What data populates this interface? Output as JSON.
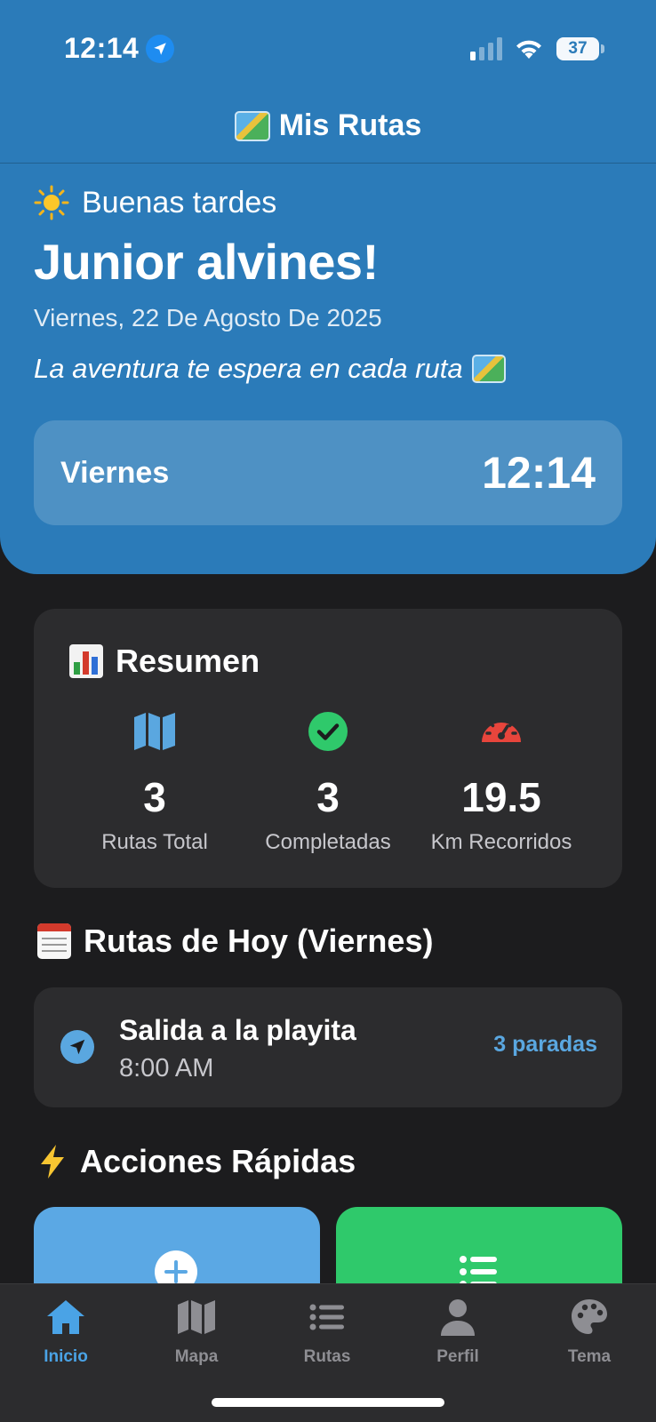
{
  "status_bar": {
    "time": "12:14",
    "battery": "37",
    "icons": [
      "location-arrow-icon",
      "cellular-signal-icon",
      "wifi-icon",
      "battery-icon"
    ]
  },
  "header": {
    "title": "Mis Rutas",
    "title_icon": "world-map-emoji-icon",
    "greeting_icon": "sun-emoji-icon",
    "greeting": "Buenas tardes",
    "user_name": "Junior alvines!",
    "date": "Viernes, 22 De Agosto De 2025",
    "tagline": "La aventura te espera en cada ruta",
    "day_card": {
      "day": "Viernes",
      "time": "12:14"
    },
    "color": "#2b7bb9"
  },
  "summary": {
    "title": "Resumen",
    "title_icon": "bar-chart-emoji-icon",
    "stats": [
      {
        "value": "3",
        "label": "Rutas Total",
        "icon": "map-icon",
        "color": "#5aa7e0"
      },
      {
        "value": "3",
        "label": "Completadas",
        "icon": "check-circle-icon",
        "color": "#2fc96b"
      },
      {
        "value": "19.5",
        "label": "Km Recorridos",
        "icon": "speedometer-icon",
        "color": "#e8453c"
      }
    ]
  },
  "today": {
    "title": "Rutas de Hoy (Viernes)",
    "title_icon": "calendar-emoji-icon",
    "routes": [
      {
        "name": "Salida a la playita",
        "time": "8:00 AM",
        "stops": "3 paradas",
        "icon": "navigation-arrow-icon"
      }
    ]
  },
  "quick_actions": {
    "title": "Acciones Rápidas",
    "title_icon": "lightning-emoji-icon",
    "buttons": [
      {
        "icon": "plus-circle-icon",
        "color": "#5ba8e4"
      },
      {
        "icon": "list-icon",
        "color": "#2fc96b"
      }
    ]
  },
  "tab_bar": {
    "active_color": "#4aa3e6",
    "tabs": [
      {
        "label": "Inicio",
        "icon": "home-icon",
        "active": true
      },
      {
        "label": "Mapa",
        "icon": "map-icon",
        "active": false
      },
      {
        "label": "Rutas",
        "icon": "list-icon",
        "active": false
      },
      {
        "label": "Perfil",
        "icon": "person-icon",
        "active": false
      },
      {
        "label": "Tema",
        "icon": "palette-icon",
        "active": false
      }
    ]
  }
}
